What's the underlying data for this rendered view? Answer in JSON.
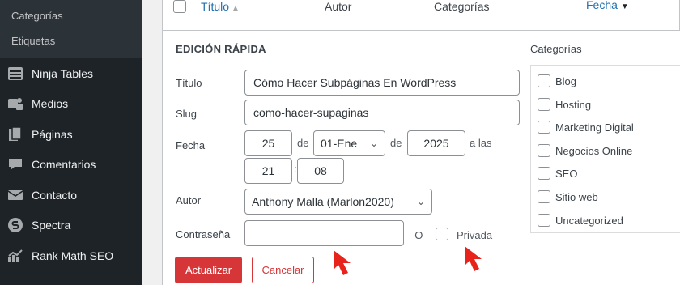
{
  "sidebar": {
    "submenu": [
      {
        "label": "Categorías"
      },
      {
        "label": "Etiquetas"
      }
    ],
    "items": [
      {
        "label": "Ninja Tables",
        "icon": "table-icon"
      },
      {
        "label": "Medios",
        "icon": "media-icon"
      },
      {
        "label": "Páginas",
        "icon": "pages-icon"
      },
      {
        "label": "Comentarios",
        "icon": "comments-icon"
      },
      {
        "label": "Contacto",
        "icon": "mail-icon"
      },
      {
        "label": "Spectra",
        "icon": "spectra-icon"
      },
      {
        "label": "Rank Math SEO",
        "icon": "chart-icon"
      }
    ]
  },
  "table_header": {
    "title": "Título",
    "author": "Autor",
    "categories": "Categorías",
    "date": "Fecha"
  },
  "quick_edit": {
    "heading": "EDICIÓN RÁPIDA",
    "title_label": "Título",
    "title_value": "Cómo Hacer Subpáginas En WordPress",
    "slug_label": "Slug",
    "slug_value": "como-hacer-supaginas",
    "date_label": "Fecha",
    "day": "25",
    "de1": "de",
    "month": "01-Ene",
    "de2": "de",
    "year": "2025",
    "a_las": "a las",
    "hour": "21",
    "colon": ":",
    "minute": "08",
    "author_label": "Autor",
    "author_value": "Anthony Malla (Marlon2020)",
    "password_label": "Contraseña",
    "password_value": "",
    "or": "–O–",
    "private_label": "Privada",
    "update_button": "Actualizar",
    "cancel_button": "Cancelar"
  },
  "categories": {
    "title": "Categorías",
    "items": [
      "Blog",
      "Hosting",
      "Marketing Digital",
      "Negocios Online",
      "SEO",
      "Sitio web",
      "Uncategorized"
    ]
  },
  "colors": {
    "sidebar_bg": "#1d2327",
    "accent_red": "#d63638",
    "link_blue": "#2271b1",
    "arrow_red": "#e8231c"
  }
}
